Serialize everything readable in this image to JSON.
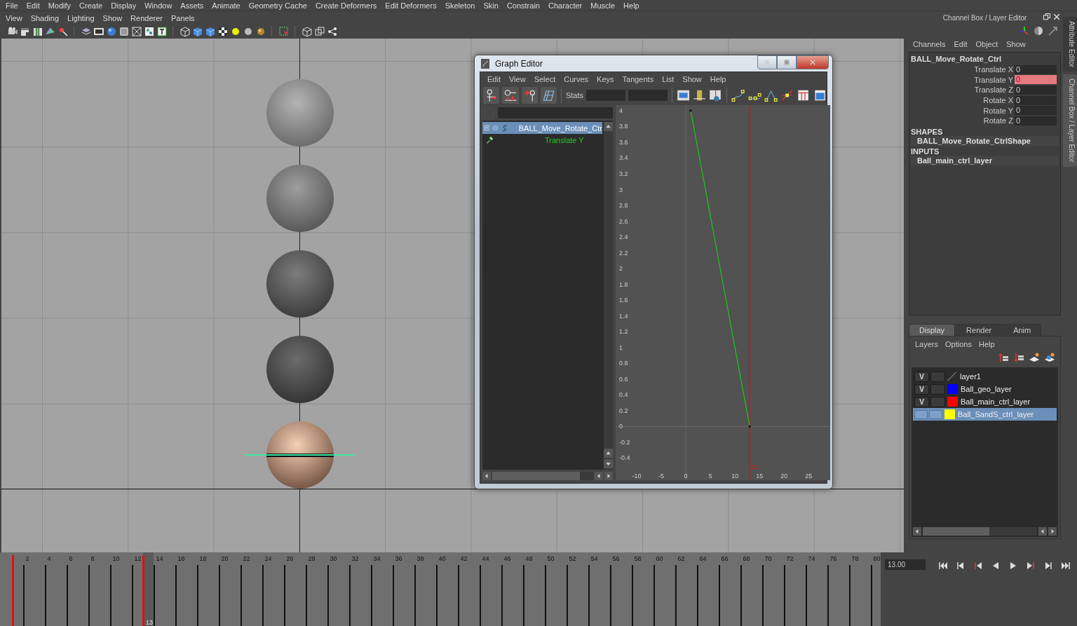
{
  "main_menu": [
    "File",
    "Edit",
    "Modify",
    "Create",
    "Display",
    "Window",
    "Assets",
    "Animate",
    "Geometry Cache",
    "Create Deformers",
    "Edit Deformers",
    "Skeleton",
    "Skin",
    "Constrain",
    "Character",
    "Muscle",
    "Help"
  ],
  "panel_menu": [
    "View",
    "Shading",
    "Lighting",
    "Show",
    "Renderer",
    "Panels"
  ],
  "graph_editor": {
    "title": "Graph Editor",
    "menu": [
      "Edit",
      "View",
      "Select",
      "Curves",
      "Keys",
      "Tangents",
      "List",
      "Show",
      "Help"
    ],
    "stats_label": "Stats",
    "outliner": {
      "object": {
        "name": "BALL_Move_Rotate_Ctr",
        "selected": true
      }
    },
    "chart_data": {
      "type": "line",
      "x": [
        1,
        13
      ],
      "series": [
        {
          "name": "Translate Y",
          "color": "#1fbf1f",
          "marker": "square",
          "values": [
            4,
            0
          ]
        }
      ],
      "xlim": [
        -14.3,
        29.4
      ],
      "ylim": [
        -0.68,
        4.07
      ],
      "xticks": [
        -10,
        -5,
        0,
        5,
        10,
        15,
        20,
        25
      ],
      "yticks": [
        4,
        3.8,
        3.6,
        3.4,
        3.2,
        3,
        2.8,
        2.6,
        2.4,
        2.2,
        2,
        1.8,
        1.6,
        1.4,
        1.2,
        1,
        0.8,
        0.6,
        0.4,
        0.2,
        0,
        -0.2,
        -0.4
      ],
      "ref_lines": [
        {
          "axis": "x",
          "value": 13,
          "color": "#e01010"
        }
      ],
      "annotations": [
        "13"
      ]
    }
  },
  "channel_box": {
    "title": "Channel Box / Layer Editor",
    "menu": [
      "Channels",
      "Edit",
      "Object",
      "Show"
    ],
    "object": "BALL_Move_Rotate_Ctrl",
    "channels": [
      {
        "name": "Translate X",
        "value": "0",
        "keyed": false
      },
      {
        "name": "Translate Y",
        "value": "0",
        "keyed": true
      },
      {
        "name": "Translate Z",
        "value": "0",
        "keyed": false
      },
      {
        "name": "Rotate X",
        "value": "0",
        "keyed": false
      },
      {
        "name": "Rotate Y",
        "value": "0",
        "keyed": false
      },
      {
        "name": "Rotate Z",
        "value": "0",
        "keyed": false
      }
    ],
    "shapes_heading": "SHAPES",
    "shapes": [
      "BALL_Move_Rotate_CtrlShape"
    ],
    "inputs_heading": "INPUTS",
    "inputs": [
      "Ball_main_ctrl_layer"
    ]
  },
  "layer_editor": {
    "tabs": [
      {
        "label": "Display",
        "selected": true
      },
      {
        "label": "Render",
        "selected": false
      },
      {
        "label": "Anim",
        "selected": false
      }
    ],
    "menu": [
      "Layers",
      "Options",
      "Help"
    ],
    "layers": [
      {
        "visibility": "V",
        "name": "layer1",
        "selected": false
      },
      {
        "visibility": "V",
        "color": "#0000ff",
        "name": "Ball_geo_layer",
        "selected": false
      },
      {
        "visibility": "V",
        "color": "#ff0000",
        "name": "Ball_main_ctrl_layer",
        "selected": false
      },
      {
        "color": "#ffff00",
        "name": "Ball_SandS_ctrl_layer",
        "selected": true
      }
    ]
  },
  "side_tabs": [
    {
      "label": "Attribute Editor",
      "selected": false
    },
    {
      "label": "Channel Box / Layer Editor",
      "selected": true
    }
  ],
  "time_slider": {
    "frame_labels": [
      "2",
      "4",
      "6",
      "8",
      "10",
      "12",
      "14",
      "16",
      "18",
      "20",
      "22",
      "24",
      "26",
      "28",
      "30",
      "32",
      "34",
      "36",
      "38",
      "40",
      "42",
      "44",
      "46",
      "48",
      "50",
      "52",
      "54",
      "56",
      "58",
      "60",
      "62",
      "64",
      "66",
      "68",
      "70",
      "72",
      "74",
      "76",
      "78",
      "80"
    ],
    "keys": [
      {
        "level": 0
      },
      {
        "level": 0.152
      }
    ],
    "current_frame": {
      "label": "13",
      "level": 0.152
    }
  },
  "playback": {
    "current_time": "13.00"
  }
}
